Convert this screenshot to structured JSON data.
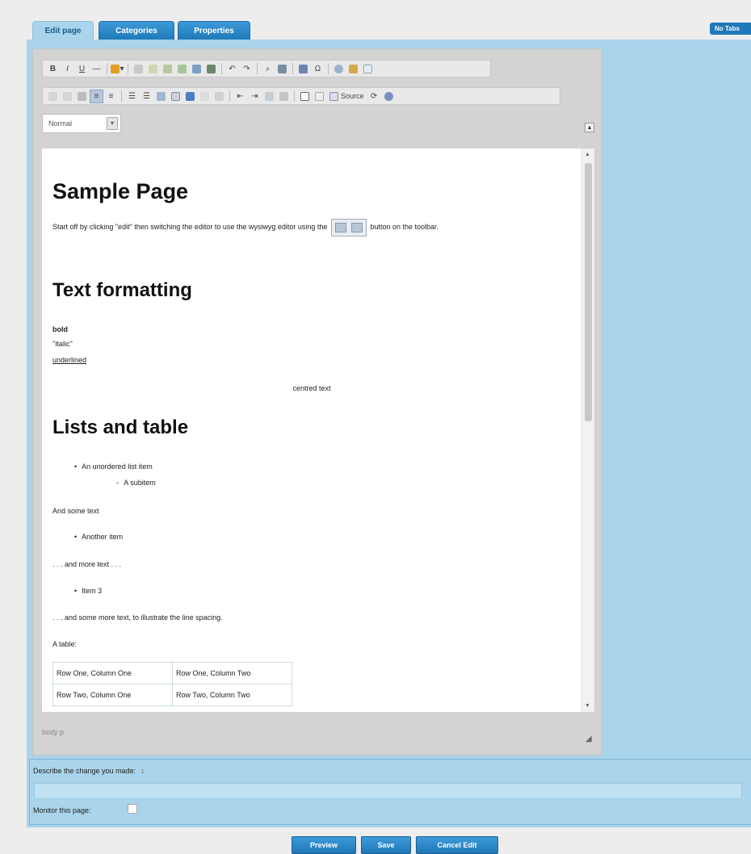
{
  "tabs": [
    {
      "label": "Edit page"
    },
    {
      "label": "Categories"
    },
    {
      "label": "Properties"
    }
  ],
  "no_tabs_label": "No Tabs",
  "toolbar": {
    "bold": "B",
    "italic": "I",
    "underline": "U",
    "source_label": "Source",
    "format_value": "Normal"
  },
  "content": {
    "title": "Sample Page",
    "intro_before": "Start off by clicking \"edit\" then switching the editor to use the wysiwyg editor using the",
    "intro_after": "button on the toolbar.",
    "h_text_formatting": "Text formatting",
    "bold_text": "bold",
    "italic_text": "''italic''",
    "underlined_text": "underlined",
    "centred_text": "centred text",
    "h_lists": "Lists and table",
    "list_item_1": "An unordered list item",
    "subitem": "A subitem",
    "some_text": "And some text",
    "another_item": "Another item",
    "more_text": ". . . and more text . . .",
    "item_3": "Item 3",
    "line_spacing_text": ". . . and some more text, to illustrate the line spacing.",
    "table_caption": "A table:",
    "table": [
      [
        "Row One, Column One",
        "Row One, Column Two"
      ],
      [
        "Row Two, Column One",
        "Row Two, Column Two"
      ]
    ]
  },
  "statusbar": "body  p",
  "describe_label": "Describe the change you made:",
  "monitor_label": "Monitor this page:",
  "buttons": {
    "preview": "Preview",
    "save": "Save",
    "cancel": "Cancel Edit"
  }
}
